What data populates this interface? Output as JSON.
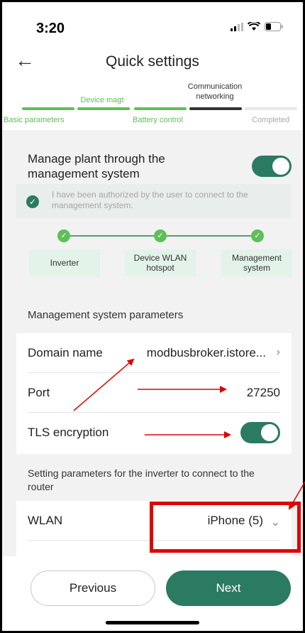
{
  "status_bar": {
    "time": "3:20"
  },
  "header": {
    "title": "Quick settings",
    "back_icon": "back-arrow-icon"
  },
  "steps": {
    "top_labels": [
      "Device magt",
      "Communication networking"
    ],
    "bottom_labels": [
      "Basic parameters",
      "Battery control",
      "Completed"
    ],
    "colors": {
      "done": "#5fbf57",
      "current": "#333333",
      "pending": "#e8e8e8"
    }
  },
  "management": {
    "toggle_label": "Manage plant through the management system",
    "toggle_on": true,
    "authorized_text": "I have been authorized by the user to connect to the management system.",
    "flow_nodes": [
      "Inverter",
      "Device WLAN hotspot",
      "Management system"
    ]
  },
  "params": {
    "section_title": "Management system parameters",
    "domain_label": "Domain name",
    "domain_value": "modbusbroker.istore...",
    "port_label": "Port",
    "port_value": "27250",
    "tls_label": "TLS encryption",
    "tls_on": true
  },
  "router": {
    "section_title": "Setting parameters for the inverter to connect to the router",
    "wlan_label": "WLAN",
    "wlan_value": "iPhone (5)"
  },
  "footer": {
    "previous_label": "Previous",
    "next_label": "Next"
  },
  "accent_color": "#2b7a62",
  "annotation_color": "#e00000"
}
